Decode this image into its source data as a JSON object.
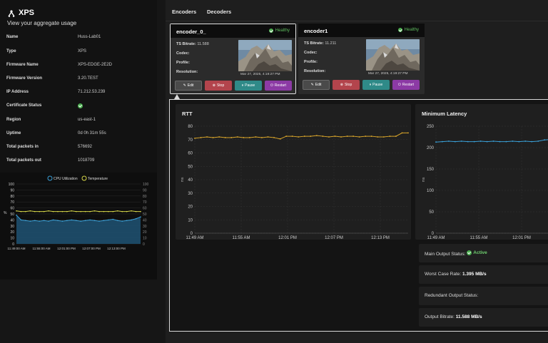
{
  "app": {
    "brand": "XPS",
    "subtitle": "View your aggregate usage"
  },
  "info": [
    {
      "label": "Name",
      "value": "Huss-Lab01"
    },
    {
      "label": "Type",
      "value": "XPS"
    },
    {
      "label": "Firmware Name",
      "value": "XPS-EDGE-2E2D"
    },
    {
      "label": "Firmware Version",
      "value": "3.20.TEST"
    },
    {
      "label": "IP Address",
      "value": "71.212.53.239"
    },
    {
      "label": "Certificate Status",
      "value": ""
    },
    {
      "label": "Region",
      "value": "us-east-1"
    },
    {
      "label": "Uptime",
      "value": "0d 0h 31m 55s"
    },
    {
      "label": "Total packets in",
      "value": "576692"
    },
    {
      "label": "Total packets out",
      "value": "1018709"
    }
  ],
  "tabs": {
    "encoders": "Encoders",
    "decoders": "Decoders"
  },
  "encoders": [
    {
      "name": "encoder_0_",
      "health": "Healthy",
      "bitrate_label": "TS Bitrate:",
      "bitrate": "11.588",
      "codec_label": "Codec:",
      "profile_label": "Profile:",
      "resolution_label": "Resolution:",
      "timestamp": "Mar 27, 2025, 4:19:27 PM"
    },
    {
      "name": "encoder1",
      "health": "Healthy",
      "bitrate_label": "TS Bitrate:",
      "bitrate": "11.211",
      "codec_label": "Codec:",
      "profile_label": "Profile:",
      "resolution_label": "Resolution:",
      "timestamp": "Mar 27, 2025, 4:19:27 PM"
    }
  ],
  "buttons": {
    "edit": "Edit",
    "stop": "Stop",
    "pause": "Pause",
    "restart": "Restart"
  },
  "status": {
    "main_output_label": "Main Output Status:",
    "main_output_value": "Active",
    "worst_case_label": "Worst Case Rate:",
    "worst_case_value": "1.395 MB/s",
    "redundant_label": "Redundant Output Status:",
    "output_bitrate_label": "Output Bitrate:",
    "output_bitrate_value": "11.588 MB/s"
  },
  "colors": {
    "cpu": "#3aa0d8",
    "temperature": "#d8d84a",
    "rtt": "#d9a52a",
    "latency": "#3aa0d8",
    "healthy": "#4caf50"
  },
  "chart_data": [
    {
      "type": "line",
      "legend": [
        "CPU Utilization",
        "Temperature"
      ],
      "x": [
        "11:49:00 AM",
        "11:55:00 AM",
        "12:01:00 PM",
        "12:07:00 PM",
        "12:13:00 PM"
      ],
      "ylim": [
        0,
        100
      ],
      "y_ticks": [
        0,
        10,
        20,
        30,
        40,
        50,
        60,
        70,
        80,
        90,
        100
      ],
      "y2_ticks": [
        0,
        10,
        20,
        30,
        40,
        50,
        60,
        70,
        80,
        90,
        100
      ],
      "ylabel": "%",
      "series": [
        {
          "name": "CPU Utilization",
          "values": [
            48,
            40,
            39,
            38,
            39,
            38,
            39,
            38,
            40,
            39,
            38,
            39,
            40,
            39,
            38,
            39,
            40,
            39,
            38,
            39,
            40,
            41,
            39,
            38,
            39,
            40,
            42,
            45
          ]
        },
        {
          "name": "Temperature",
          "values": [
            55,
            54,
            54,
            55,
            54,
            54,
            54,
            55,
            54,
            54,
            54,
            54,
            55,
            54,
            54,
            54,
            54,
            55,
            54,
            54,
            54,
            54,
            55,
            54,
            54,
            55,
            54,
            54
          ]
        }
      ]
    },
    {
      "type": "line",
      "title": "RTT",
      "ylabel": "ms",
      "x": [
        "11:49 AM",
        "11:55 AM",
        "12:01 PM",
        "12:07 PM",
        "12:13 PM"
      ],
      "ylim": [
        0,
        80
      ],
      "y_ticks": [
        0,
        10,
        20,
        30,
        40,
        50,
        60,
        70,
        80
      ],
      "series": [
        {
          "name": "RTT",
          "values": [
            71,
            71.5,
            72,
            71.5,
            72,
            71.5,
            71.5,
            72,
            71.5,
            71.5,
            72,
            71.5,
            72,
            71.5,
            70.5,
            72.5,
            72.5,
            72,
            72.5,
            72.5,
            73,
            72.5,
            72,
            72.5,
            72,
            72.5,
            72.5,
            72,
            72.5,
            72.5,
            72,
            72,
            72.5,
            72.5,
            75,
            75
          ]
        }
      ]
    },
    {
      "type": "line",
      "title": "Minimum Latency",
      "ylabel": "ms",
      "x": [
        "11:49 AM",
        "11:55 AM",
        "12:01 PM"
      ],
      "ylim": [
        0,
        250
      ],
      "y_ticks": [
        0,
        50,
        100,
        150,
        200,
        250
      ],
      "series": [
        {
          "name": "Minimum Latency",
          "values": [
            213,
            214,
            215,
            214,
            215,
            214,
            214,
            215,
            214,
            215,
            214,
            214,
            215,
            214,
            215,
            214,
            215,
            218,
            219,
            219
          ]
        }
      ]
    }
  ]
}
